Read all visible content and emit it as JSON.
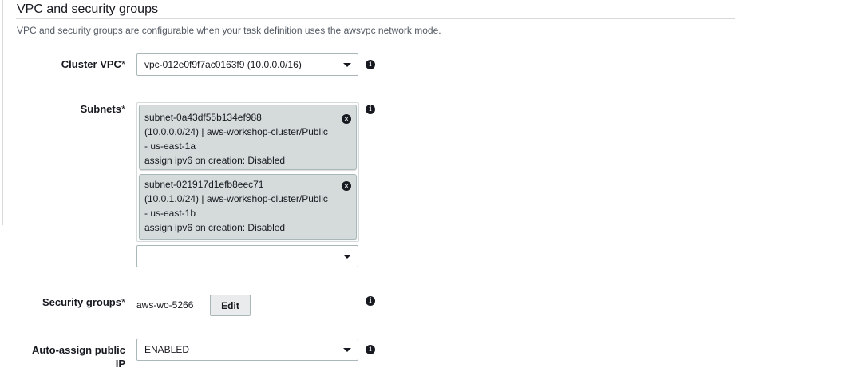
{
  "section": {
    "title": "VPC and security groups",
    "description": "VPC and security groups are configurable when your task definition uses the awsvpc network mode."
  },
  "cluster_vpc": {
    "label": "Cluster VPC",
    "required_mark": "*",
    "value": "vpc-012e0f9f7ac0163f9 (10.0.0.0/16)"
  },
  "subnets": {
    "label": "Subnets",
    "required_mark": "*",
    "selected": [
      {
        "line1": "subnet-0a43df55b134ef988",
        "line2": "(10.0.0.0/24) | aws-workshop-cluster/Public",
        "line3": "- us-east-1a",
        "line4": "assign ipv6 on creation: Disabled"
      },
      {
        "line1": "subnet-021917d1efb8eec71",
        "line2": "(10.0.1.0/24) | aws-workshop-cluster/Public",
        "line3": "- us-east-1b",
        "line4": "assign ipv6 on creation: Disabled"
      }
    ],
    "dropdown_value": ""
  },
  "security_groups": {
    "label": "Security groups",
    "required_mark": "*",
    "value": "aws-wo-5266",
    "edit_label": "Edit"
  },
  "auto_assign_ip": {
    "label_line1": "Auto-assign public",
    "label_line2": "IP",
    "value": "ENABLED"
  },
  "icons": {
    "info": "info-icon",
    "remove": "close-circle-icon",
    "dropdown": "caret-down-icon"
  }
}
